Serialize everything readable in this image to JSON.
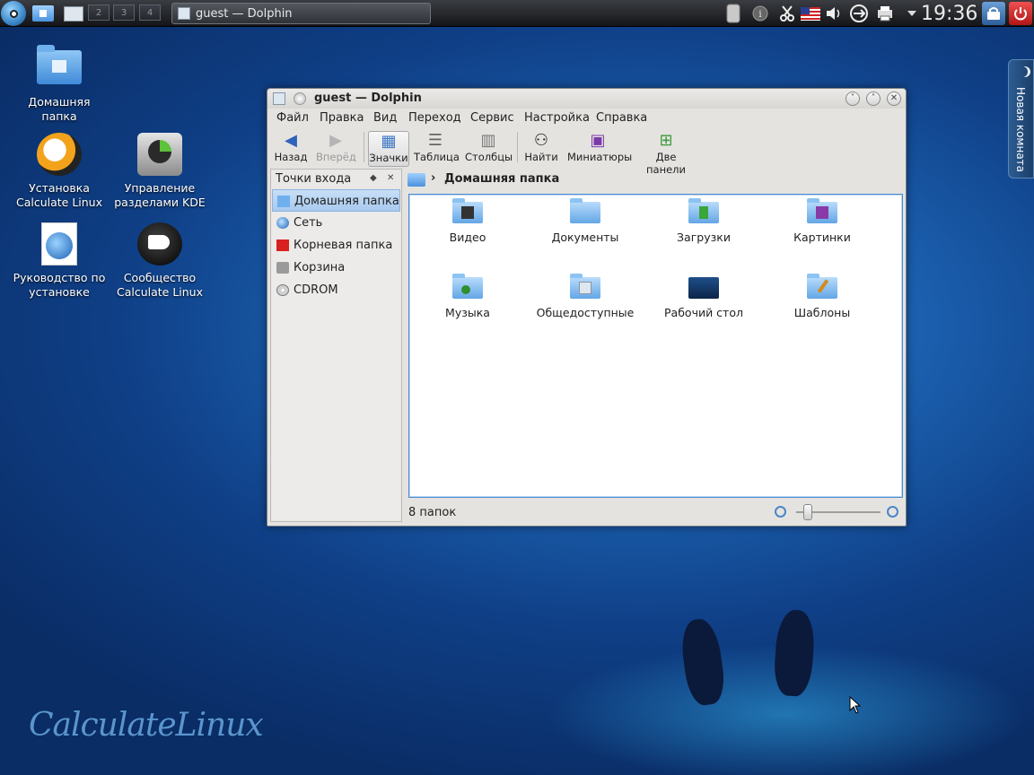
{
  "taskbar": {
    "desktops": [
      "2",
      "3",
      "4"
    ],
    "task_title": "guest — Dolphin",
    "clock": "19:36"
  },
  "desktop_icons": [
    {
      "label": "Домашняя папка"
    },
    {
      "label": "Установка Calculate Linux"
    },
    {
      "label": "Управление разделами KDE"
    },
    {
      "label": "Руководство по установке"
    },
    {
      "label": "Сообщество Calculate Linux"
    }
  ],
  "side_widget": {
    "label": "Новая комната"
  },
  "window": {
    "title": "guest — Dolphin",
    "menu": [
      "Файл",
      "Правка",
      "Вид",
      "Переход",
      "Сервис",
      "Настройка",
      "Справка"
    ],
    "toolbar": [
      {
        "label": "Назад",
        "icon": "back-arrow-icon",
        "disabled": false
      },
      {
        "label": "Вперёд",
        "icon": "forward-arrow-icon",
        "disabled": true
      },
      {
        "label": "Значки",
        "icon": "icons-view-icon",
        "active": true
      },
      {
        "label": "Таблица",
        "icon": "details-view-icon"
      },
      {
        "label": "Столбцы",
        "icon": "columns-view-icon"
      },
      {
        "label": "Найти",
        "icon": "binoculars-icon"
      },
      {
        "label": "Миниатюры",
        "icon": "preview-icon"
      },
      {
        "label": "Две панели",
        "icon": "split-view-icon"
      }
    ],
    "places": {
      "title": "Точки входа",
      "items": [
        {
          "label": "Домашняя папка",
          "selected": true
        },
        {
          "label": "Сеть"
        },
        {
          "label": "Корневая папка"
        },
        {
          "label": "Корзина"
        },
        {
          "label": "CDROM"
        }
      ]
    },
    "breadcrumb": {
      "current": "Домашняя папка"
    },
    "files": [
      {
        "label": "Видео",
        "emblem": "film-clapper"
      },
      {
        "label": "Документы",
        "emblem": "document"
      },
      {
        "label": "Загрузки",
        "emblem": "download-arrow"
      },
      {
        "label": "Картинки",
        "emblem": "picture"
      },
      {
        "label": "Музыка",
        "emblem": "music-note"
      },
      {
        "label": "Общедоступные",
        "emblem": "public"
      },
      {
        "label": "Рабочий стол",
        "emblem": "desktop"
      },
      {
        "label": "Шаблоны",
        "emblem": "pencil"
      }
    ],
    "status": "8 папок",
    "colors": {
      "selection": "#a8c9ee",
      "view_border": "#4c8bd4"
    }
  },
  "wallpaper": {
    "logo": "CalculateLinux"
  }
}
